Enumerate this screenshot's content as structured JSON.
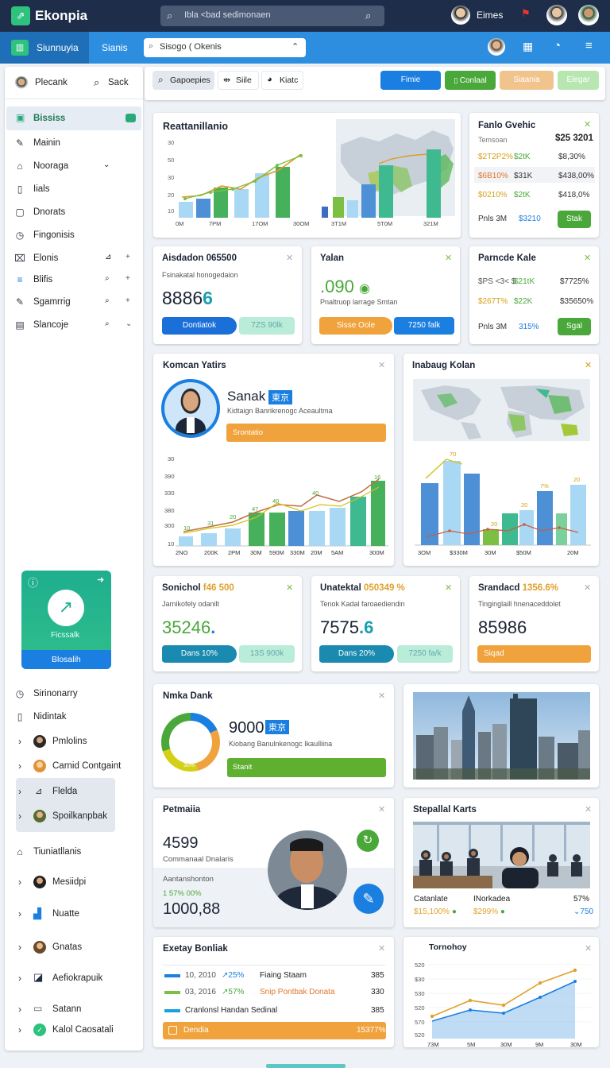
{
  "topbar": {
    "app_name": "Ekonpia",
    "search_placeholder": "Ibla ˂bad sedimonaen",
    "user_name": "Eimes"
  },
  "subbar": {
    "section": "Siunnuyia",
    "tab": "Sianis",
    "dropdown_value": "Sisogo ( Okenis"
  },
  "sidebar": {
    "top_left": "Plecank",
    "top_right": "Sack",
    "items": [
      {
        "label": "Bississ",
        "active": true
      },
      {
        "label": "Mainin"
      },
      {
        "label": "Nooraga"
      },
      {
        "label": "Iials"
      },
      {
        "label": "Dnorats"
      },
      {
        "label": "Fingonisis"
      },
      {
        "label": "Elonis"
      },
      {
        "label": "Blifis"
      },
      {
        "label": "Sgamrrig"
      },
      {
        "label": "Slancoje"
      }
    ],
    "promo": {
      "label": "Ficssalk",
      "button": "Blosalih"
    },
    "bottom_items": [
      {
        "label": "Sirinonarry"
      },
      {
        "label": "Nidintak"
      },
      {
        "label": "Pmlolins"
      },
      {
        "label": "Carnid Contgaint"
      },
      {
        "label": "Flelda"
      },
      {
        "label": "Spoilkanpbak"
      },
      {
        "label": "Tiuniatllanis"
      },
      {
        "label": "Mesiidpi"
      },
      {
        "label": "Nuatte"
      },
      {
        "label": "Gnatas"
      },
      {
        "label": "Aefiokrapuik"
      },
      {
        "label": "Satann"
      },
      {
        "label": "Kalol Caosatali"
      }
    ]
  },
  "toolbar": {
    "filters": [
      "Gapoepies",
      "Siile",
      "Kiatc"
    ],
    "buttons": [
      "Fimie",
      "Conlaal",
      "Siaania",
      "Elegar"
    ],
    "colors": [
      "#1a7fe0",
      "#4aa83a",
      "#f2c48d",
      "#b8e6b0"
    ]
  },
  "cards": {
    "c1": {
      "title": "Reattanillanio",
      "yticks": [
        "30",
        "50",
        "30",
        "20",
        "10"
      ],
      "xticks": [
        "0M",
        "7PM",
        "17OM",
        "30OM",
        "3T1M",
        "5T0M",
        "321M"
      ]
    },
    "c2": {
      "title": "Fanlo Gvehic",
      "value": "$25 3201",
      "sub": "Temsoan",
      "rows": [
        {
          "a": "$2T2P2%",
          "b": "$2tK",
          "c": "$8,30%"
        },
        {
          "a": "$6B10%",
          "b": "$31K",
          "c": "$438,00%"
        },
        {
          "a": "$0210%",
          "b": "$2tK",
          "c": "$418,0%"
        },
        {
          "a": "Pnls 3M",
          "b": "$3210",
          "c": ""
        }
      ],
      "button": "Stak"
    },
    "c3": {
      "title": "Aisdadon 065500",
      "sub": "Fsinakatal honogedaion",
      "value": "8886",
      "digit": "6",
      "btn1": "Dontiatok",
      "btn2": "7ZS 90lk"
    },
    "c4": {
      "title": "Yalan",
      "value": ".090",
      "sub": "Pnaltruop larrage Smtan",
      "btn1": "Sisse Oole",
      "btn2": "7250 falk"
    },
    "c5": {
      "title": "Parncde Kale",
      "rows": [
        {
          "a": "$PS ˂3˂ $",
          "b": "$21tK",
          "c": "$7725%"
        },
        {
          "a": "$267T%",
          "b": "$22K",
          "c": "$35650%"
        },
        {
          "a": "Pnls 3M",
          "b": "315%",
          "c": ""
        }
      ],
      "button": "Sgal"
    },
    "c6": {
      "title": "Komcan Yatirs",
      "name": "Sanak",
      "badge": "東京",
      "sub": "Kidtaign Banrikrenogc Aceaultma",
      "bar": "Srontatio",
      "yticks": [
        "30",
        "390",
        "330",
        "380",
        "300",
        "10"
      ],
      "xticks": [
        "2NO",
        "200K",
        "2PM",
        "30M",
        "590M",
        "330M",
        "20M",
        "5AM",
        "300M"
      ],
      "labels": [
        "10",
        "31",
        "20",
        "47",
        "40",
        "40",
        "16"
      ]
    },
    "c7": {
      "title": "Inabaug Kolan",
      "labels": [
        "70",
        "20",
        "20",
        "7%",
        "20"
      ],
      "xticks": [
        "3OM",
        "$330M",
        "30M",
        "$50M",
        "20M"
      ]
    },
    "c8": {
      "title": "Sonichol",
      "accent": "f46 500",
      "sub": "Jarnikofely odanilt",
      "value": "35246",
      "digit": ".",
      "btn1": "Dans 10%",
      "btn2": "13S 900k"
    },
    "c9": {
      "title": "Unatektal",
      "accent": "050349 %",
      "sub": "Tenok Kadal faroaediendin",
      "value": "7575",
      "digit": ".6",
      "btn1": "Dans 20%",
      "btn2": "7250 fa/k"
    },
    "c10": {
      "title": "Srandacd",
      "accent": "1356.6%",
      "sub": "Tinginglaill hnenaceddolet",
      "value": "85986",
      "digit": "",
      "button": "Siqad"
    },
    "c11": {
      "title": "Nmka Dank",
      "value": "9000",
      "badge": "東京",
      "sub": "Kiobang Banulnkenogc Ikaulliina",
      "bar": "Stanit",
      "ring_label": "30%"
    },
    "c13": {
      "title": "Petmaiia",
      "value": "4599",
      "sub": "Commanaal Dnalaris",
      "sub2": "Aantanshonton",
      "accent": "1 57% 00%",
      "big": "1000,88"
    },
    "c14": {
      "title": "Stepallal Karts",
      "l1": "Catanlate",
      "l2": "INorkadea",
      "l3": "57%",
      "v1": "$15,100%",
      "v2": "$299%",
      "v3": "750"
    },
    "c15": {
      "title": "Exetay Bonliak",
      "rows": [
        {
          "a": "10, 2010",
          "b": "25%",
          "c": "Fiaing Staam",
          "d": "385",
          "color": "#1a7fe0"
        },
        {
          "a": "03, 2016",
          "b": "57%",
          "c": "Snip Pontbak Donata",
          "d": "330",
          "color": "#7bc043"
        },
        {
          "a": "Cranlonsl Handan Sedinal",
          "b": "",
          "c": "",
          "d": "385",
          "color": "#1a9fe0"
        }
      ],
      "bar": "Dendia",
      "bar_value": "15377%"
    },
    "c16": {
      "title": "Tornohoy",
      "yticks": [
        "520",
        "$30",
        "530",
        "520",
        "570",
        "520"
      ],
      "xticks": [
        "73M",
        "5M",
        "30M",
        "9M",
        "30M"
      ]
    }
  }
}
